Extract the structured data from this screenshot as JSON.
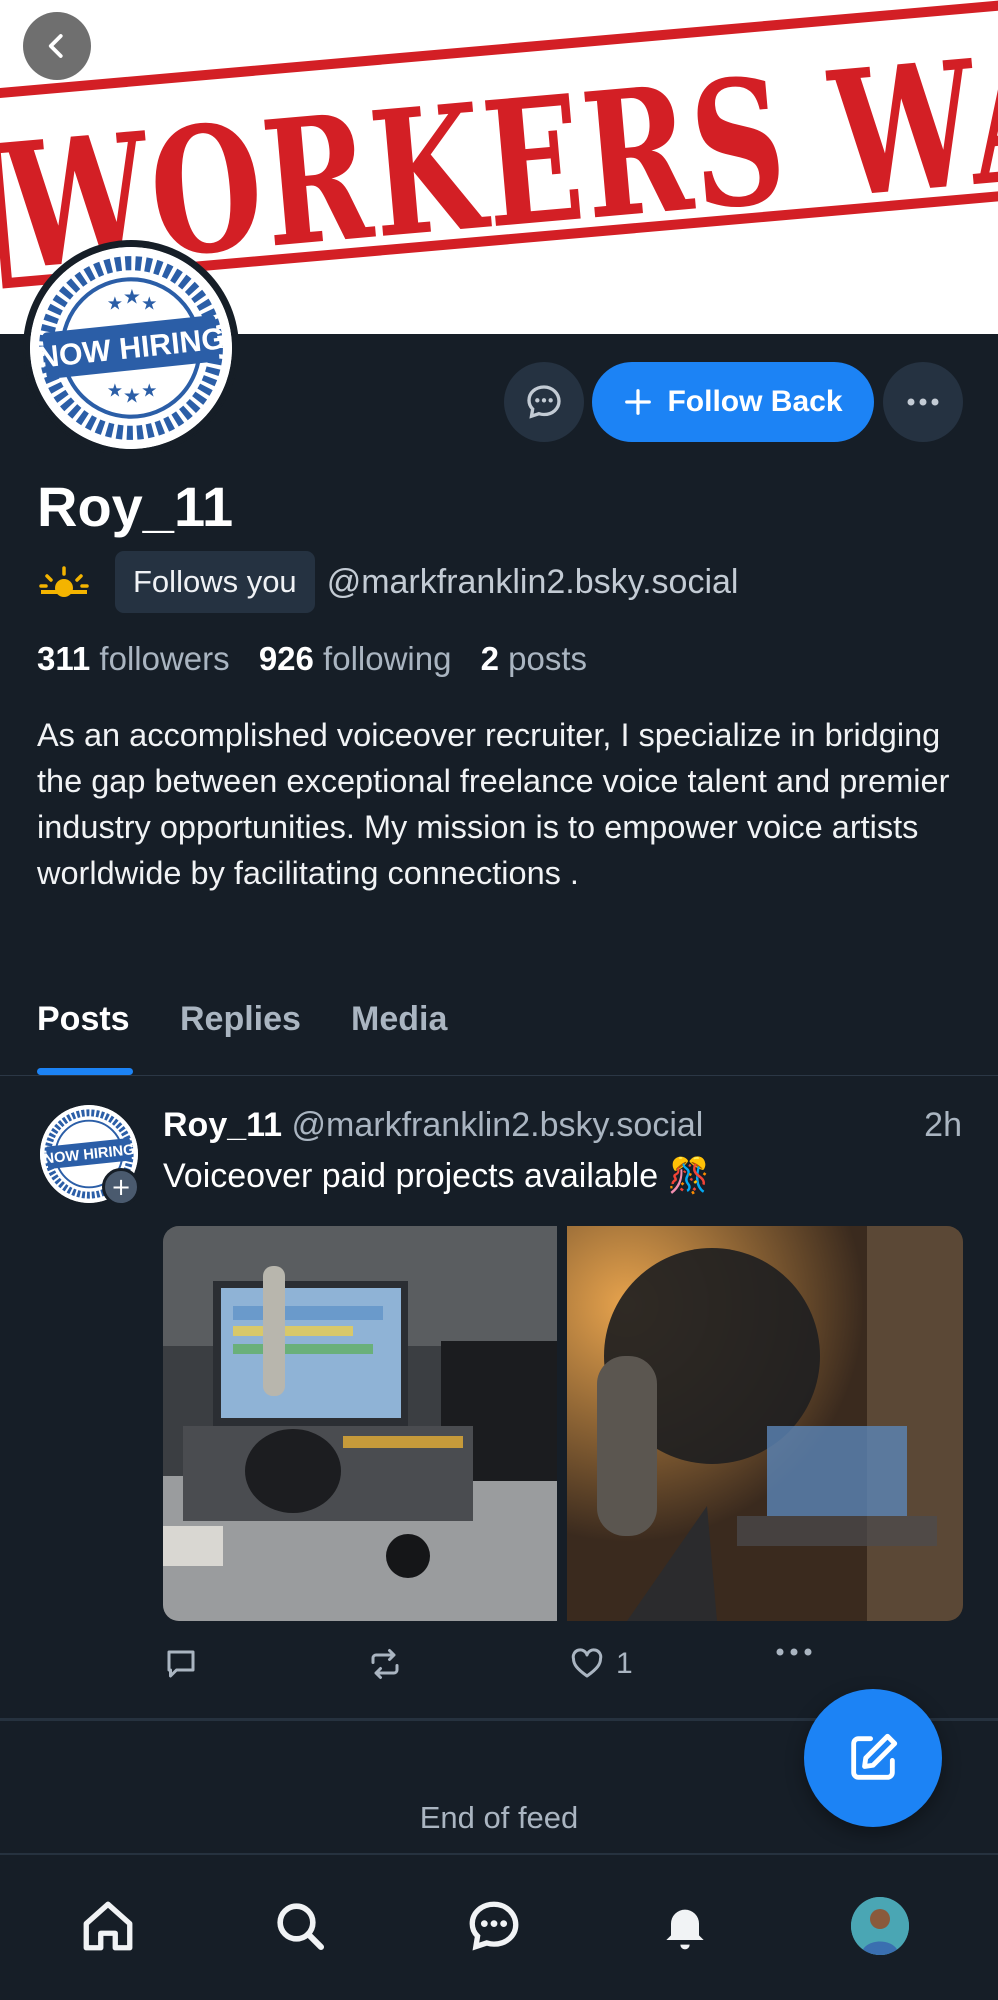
{
  "banner": {
    "text": "WORKERS WANTED",
    "color": "#d31f25"
  },
  "avatar": {
    "text": "NOW HIRING",
    "color": "#2b5ea7"
  },
  "actions": {
    "follow_back_label": "Follow Back"
  },
  "profile": {
    "display_name": "Roy_11",
    "follows_you": "Follows you",
    "handle": "@markfranklin2.bsky.social",
    "followers_count": "311",
    "followers_label": "followers",
    "following_count": "926",
    "following_label": "following",
    "posts_count": "2",
    "posts_label": "posts",
    "bio": "As an accomplished voiceover recruiter, I specialize in bridging the gap between exceptional freelance voice talent and premier industry opportunities. My mission is to empower voice artists worldwide by facilitating connections ."
  },
  "tabs": [
    {
      "label": "Posts",
      "active": true
    },
    {
      "label": "Replies",
      "active": false
    },
    {
      "label": "Media",
      "active": false
    }
  ],
  "post": {
    "author": "Roy_11",
    "handle": "@markfranklin2.bsky.social",
    "time": "2h",
    "text": "Voiceover paid projects available 🎊",
    "like_count": "1"
  },
  "feed": {
    "end_text": "End of feed"
  },
  "nav": {
    "items": [
      "home-icon",
      "search-icon",
      "chat-icon",
      "bell-icon",
      "profile-avatar"
    ]
  },
  "colors": {
    "accent": "#1c83f5",
    "background": "#161e27",
    "surface": "#253241"
  }
}
